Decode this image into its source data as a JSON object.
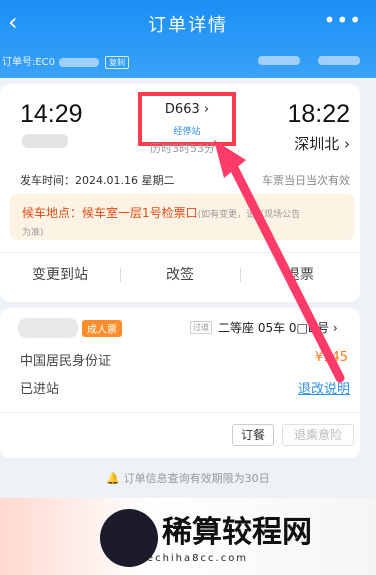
{
  "header": {
    "title": "订单详情",
    "back_icon": "‹",
    "more_icon": "•••",
    "order_label": "订单号:EC0",
    "copy_label": "复制"
  },
  "trip": {
    "dep_time": "14:29",
    "arr_time": "18:22",
    "arr_station": "深圳北 ›",
    "train_no": "D663 ›",
    "train_type": "经停站",
    "duration": "历时3时53分",
    "depart_info": "发车时间：2024.01.16 星期二",
    "validity": "车票当日当次有效",
    "gate_main": "候车地点：候车室一层1号检票口",
    "gate_note": "(如有变更，请以现场公告",
    "gate_note2": "为准)"
  },
  "actions": [
    "变更到站",
    "改签",
    "退票"
  ],
  "passenger": {
    "ticket_type": "成人票",
    "pass_tag": "过道",
    "seat": "二等座 05车 0□D号 ›",
    "id_type": "中国居民身份证",
    "price": "¥145",
    "status": "已进站",
    "refund_link": "退改说明",
    "meal_button": "订餐",
    "retreat_button": "退乘意险"
  },
  "notice": "订单信息查询有效期限为30日",
  "watermark": {
    "text": "稀算较程网",
    "url": "m.echiha8cc.com"
  },
  "colors": {
    "header_blue": "#1a8ef5",
    "highlight_red": "#ff3b4e",
    "price_orange": "#ff7a1a",
    "link_blue": "#2f8fe8"
  }
}
